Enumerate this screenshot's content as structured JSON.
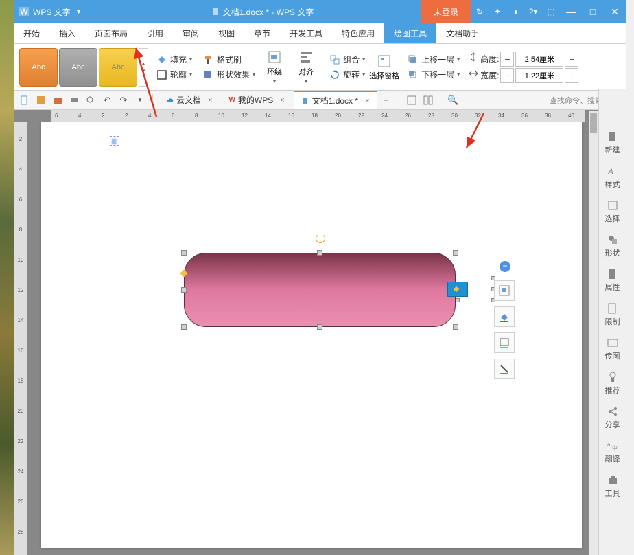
{
  "app": {
    "name": "WPS 文字",
    "doc_title": "文档1.docx * - WPS 文字",
    "login": "未登录"
  },
  "menu": {
    "items": [
      "开始",
      "插入",
      "页面布局",
      "引用",
      "审阅",
      "视图",
      "章节",
      "开发工具",
      "特色应用",
      "绘图工具",
      "文档助手"
    ],
    "active": 9
  },
  "ribbon": {
    "swatch_label": "Abc",
    "fill": "填充",
    "outline": "轮廓",
    "fmt_painter": "格式刷",
    "effects": "形状效果",
    "wrap": "环绕",
    "align": "对齐",
    "group": "组合",
    "rotate": "旋转",
    "sel_pane": "选择窗格",
    "bring_fwd": "上移一层",
    "send_back": "下移一层",
    "height_label": "高度:",
    "height_val": "2.54厘米",
    "width_label": "宽度:",
    "width_val": "1.22厘米"
  },
  "tabs": {
    "cloud": "云文档",
    "mywps": "我的WPS",
    "doc": "文档1.docx *",
    "search": "查找命令、搜索模板"
  },
  "ruler_h": [
    "6",
    "4",
    "2",
    "2",
    "4",
    "6",
    "8",
    "10",
    "12",
    "14",
    "16",
    "18",
    "20",
    "22",
    "24",
    "26",
    "28",
    "30",
    "32",
    "34",
    "36",
    "38",
    "40"
  ],
  "ruler_v": [
    "2",
    "4",
    "6",
    "8",
    "10",
    "12",
    "14",
    "16",
    "18",
    "20",
    "22",
    "24",
    "26",
    "28"
  ],
  "sidebar": {
    "items": [
      "新建",
      "样式",
      "选择",
      "形状",
      "属性",
      "限制",
      "传图",
      "推荐",
      "分享",
      "翻译",
      "工具"
    ]
  },
  "shape": {
    "fill_gradient": [
      "#7a3548",
      "#e890b0"
    ],
    "type": "rounded-rectangle"
  }
}
